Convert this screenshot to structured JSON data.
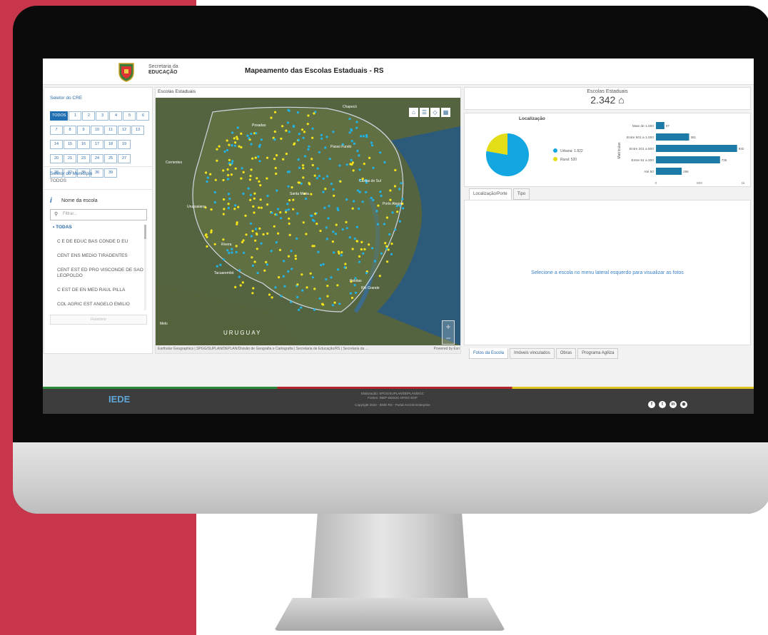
{
  "topbar": {
    "secretaria_line1": "Secretaria da",
    "secretaria_line2": "EDUCAÇÃO",
    "title": "Mapeamento das Escolas Estaduais - RS"
  },
  "sidebar": {
    "cre_title": "Seletor do CRE",
    "cre_buttons": [
      "TODOS",
      "1",
      "2",
      "3",
      "4",
      "5",
      "6",
      "7",
      "8",
      "9",
      "10",
      "11",
      "12",
      "13",
      "14",
      "15",
      "16",
      "17",
      "18",
      "19",
      "20",
      "21",
      "23",
      "24",
      "25",
      "27",
      "28",
      "32",
      "35",
      "36",
      "39"
    ],
    "municipio_title": "Seletor do Município",
    "municipio_value": "TODOS",
    "school_title": "Nome da escola",
    "filter_placeholder": "Filtrar...",
    "school_list": [
      "TODAS",
      "C E DE EDUC BAS CONDE D EU",
      "CENT ENS MEDIO TIRADENTES",
      "CENT EST ED PRO VISCONDE DE SAO LEOPOLDO",
      "C EST DE EN MED RAUL PILLA",
      "COL AGRIC EST ANGELO EMILIO"
    ],
    "report_button": "Relatório"
  },
  "map": {
    "title": "Escolas Estaduais",
    "places": [
      "Chapecó",
      "Posadas",
      "Passo Fundo",
      "Corrientes",
      "Uruguaiana",
      "Santa Maria",
      "Caxias do Sul",
      "Porto Alegre",
      "Rivera",
      "Tacuarembó",
      "Pelotas",
      "Rio Grande",
      "URUGUAY",
      "Melo"
    ],
    "attribution": "Earthstar Geographics | SPGG/SUPLAN/DEPLAN/Divisão de Geografia e Cartografia | Secretaria de Educação/RS | Secretaria da ...",
    "powered_by": "Powered by Esri"
  },
  "kpi": {
    "title": "Escolas Estaduais",
    "value": "2.342"
  },
  "chart_data": [
    {
      "type": "pie",
      "title": "Localização",
      "categories": [
        "Urbana",
        "Rural"
      ],
      "values": [
        1822,
        520
      ],
      "legend_labels": [
        "Urbana: 1.822",
        "Rural: 520"
      ],
      "colors": [
        "#13a6e0",
        "#e3dd17"
      ]
    },
    {
      "type": "bar",
      "orientation": "horizontal",
      "categories": [
        "Mais de 1.000",
        "Entre 501 a 1.000",
        "Entre 201 a 500",
        "Entre 51 a 200",
        "Até 50"
      ],
      "values": [
        97,
        381,
        932,
        736,
        296
      ],
      "ylabel": "Matrículas",
      "xlim": [
        0,
        1000
      ],
      "xticks": [
        "0",
        "500",
        "1k"
      ],
      "color": "#1c7aa6"
    }
  ],
  "tabs_top": [
    "Localização/Porte",
    "Tipo"
  ],
  "photos_message": "Selecione a escola no menu lateral esquerdo para visualizar as fotos",
  "tabs_bottom": [
    "Fotos da Escola",
    "Imóveis vinculados",
    "Obras",
    "Programa Agiliza"
  ],
  "footer": {
    "logo": "IEDE",
    "line1": "Elaboração: SPGG/SUPLAN/DEPLAN/DGC",
    "line2": "Fontes: INEP-SEDUC-SPGG-SOP",
    "line3": "Copyright 2022 - IEDE RS - Portal ArcGIS Enterprise",
    "socials": [
      "facebook-icon",
      "twitter-icon",
      "linkedin-icon",
      "instagram-icon"
    ]
  }
}
